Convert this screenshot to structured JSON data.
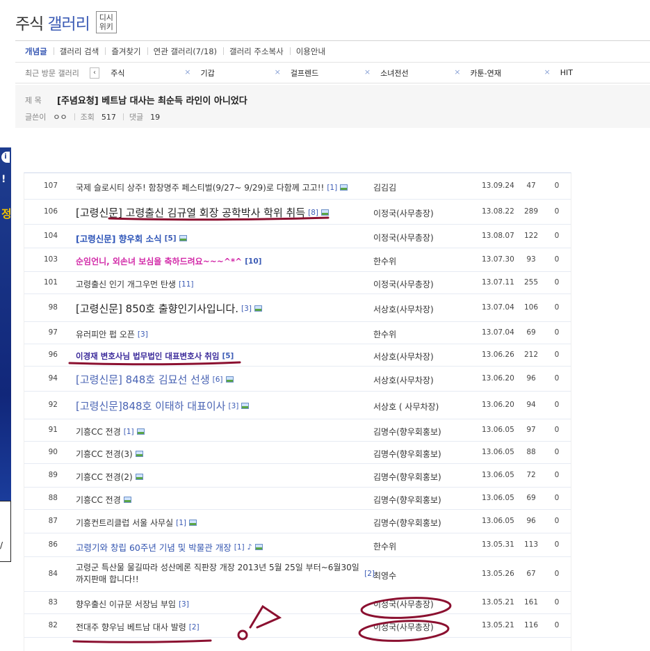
{
  "header": {
    "title_part1": "주식",
    "title_part2": "갤러리",
    "wiki_line1": "디시",
    "wiki_line2": "위키"
  },
  "menu": {
    "items": [
      "개념글",
      "갤러리 검색",
      "즐겨찾기",
      "연관 갤러리(7/18)",
      "갤러리 주소복사",
      "이용안내"
    ]
  },
  "recent": {
    "label": "최근 방문 갤러리",
    "prev_arrow": "‹",
    "close_glyph": "×",
    "galleries": [
      "주식",
      "기갑",
      "걸프렌드",
      "소녀전선",
      "카툰-연재",
      "HIT"
    ]
  },
  "post": {
    "subject_label": "제 목",
    "subject": "[주념요청] 베트남 대사는 최순득 라인이 아니었다",
    "writer_label": "글쓴이",
    "writer": "ㅇㅇ",
    "views_label": "조회",
    "views": "517",
    "comments_label": "댓글",
    "comments": "19"
  },
  "ad": {
    "c1": "i",
    "c2": "!",
    "c3": "정",
    "c4": "/"
  },
  "board": {
    "rows": [
      {
        "num": "107",
        "subject": "국제 슬로시티 상주! 함창명주 페스티벌(9/27~ 9/29)로 다함께 고고!!",
        "comments": "[1]",
        "img": true,
        "style": "",
        "writer": "김김김",
        "date": "13.09.24",
        "views": "47",
        "rec": "0"
      },
      {
        "num": "106",
        "subject": "[고령신문] 고령출신 김규열 회장 공학박사 학위 취득",
        "comments": "[8]",
        "img": true,
        "style": "s-big",
        "writer": "이정국(사무총장)",
        "date": "13.08.22",
        "views": "289",
        "rec": "0"
      },
      {
        "num": "104",
        "subject": "[고령신문] 향우회 소식",
        "comments": "[5]",
        "img": true,
        "style": "s-bold-blue",
        "writer": "이정국(사무총장)",
        "date": "13.08.07",
        "views": "122",
        "rec": "0"
      },
      {
        "num": "103",
        "subject": "순임언니, 외손녀 보심을 축하드려요~~~^*^",
        "comments": "[10]",
        "img": false,
        "style": "s-magenta",
        "writer": "한수위",
        "date": "13.07.30",
        "views": "93",
        "rec": "0"
      },
      {
        "num": "101",
        "subject": "고령출신 인기 개그우먼 탄생",
        "comments": "[11]",
        "img": false,
        "style": "",
        "writer": "이정국(사무총장)",
        "date": "13.07.11",
        "views": "255",
        "rec": "0"
      },
      {
        "num": "98",
        "subject": "[고령신문] 850호 출향인기사입니다.",
        "comments": "[3]",
        "img": true,
        "style": "s-big",
        "writer": "서상호(사무차장)",
        "date": "13.07.04",
        "views": "106",
        "rec": "0"
      },
      {
        "num": "97",
        "subject": "유러피안 펍 오픈",
        "comments": "[3]",
        "img": false,
        "style": "",
        "writer": "한수위",
        "date": "13.07.04",
        "views": "69",
        "rec": "0"
      },
      {
        "num": "96",
        "subject": "이경재 변호사님 법무법인 대표변호사 취임",
        "comments": "[5]",
        "img": false,
        "style": "s-purple",
        "writer": "서상호(사무차장)",
        "date": "13.06.26",
        "views": "212",
        "rec": "0"
      },
      {
        "num": "94",
        "subject": "[고령신문] 848호 김묘선 선생",
        "comments": "[6]",
        "img": true,
        "style": "s-big-blue",
        "writer": "서상호(사무차장)",
        "date": "13.06.20",
        "views": "96",
        "rec": "0"
      },
      {
        "num": "92",
        "subject": "[고령신문]848호 이태하 대표이사",
        "comments": "[3]",
        "img": true,
        "style": "s-big-blue",
        "writer": "서상호 ( 사무차장)",
        "date": "13.06.20",
        "views": "94",
        "rec": "0"
      },
      {
        "num": "91",
        "subject": "기흥CC 전경",
        "comments": "[1]",
        "img": true,
        "style": "",
        "writer": "김명수(향우회홍보)",
        "date": "13.06.05",
        "views": "97",
        "rec": "0"
      },
      {
        "num": "90",
        "subject": "기흥CC 전경(3)",
        "comments": "",
        "img": true,
        "style": "",
        "writer": "김명수(향우회홍보)",
        "date": "13.06.05",
        "views": "88",
        "rec": "0"
      },
      {
        "num": "89",
        "subject": "기흥CC 전경(2)",
        "comments": "",
        "img": true,
        "style": "",
        "writer": "김명수(향우회홍보)",
        "date": "13.06.05",
        "views": "72",
        "rec": "0"
      },
      {
        "num": "88",
        "subject": "기흥CC 전경",
        "comments": "",
        "img": true,
        "style": "",
        "writer": "김명수(향우회홍보)",
        "date": "13.06.05",
        "views": "69",
        "rec": "0"
      },
      {
        "num": "87",
        "subject": "기흥컨트리클럽 서울 사무실",
        "comments": "[1]",
        "img": true,
        "style": "",
        "writer": "김명수(향우회홍보)",
        "date": "13.06.05",
        "views": "96",
        "rec": "0"
      },
      {
        "num": "86",
        "subject": "고령기와 창립 60주년 기념 및 박물관 개장",
        "comments": "[1]",
        "img": true,
        "note": "♪",
        "style": "s-blue",
        "writer": "한수위",
        "date": "13.05.31",
        "views": "113",
        "rec": "0"
      },
      {
        "num": "84",
        "subject": "고령군 특산물 물길따라 성산메론 직판장 개장 2013년 5월 25일 부터~6월30일 까지판매 합니다!!",
        "comments": "[2]",
        "img": false,
        "style": "s-wrap",
        "writer": "최영수",
        "date": "13.05.26",
        "views": "67",
        "rec": "0"
      },
      {
        "num": "83",
        "subject": "향우출신 이규문 서장님 부임",
        "comments": "[3]",
        "img": false,
        "style": "",
        "writer": "이정국(사무총장)",
        "date": "13.05.21",
        "views": "161",
        "rec": "0"
      },
      {
        "num": "82",
        "subject": "전대주 향우님 베트남 대사 발령",
        "comments": "[2]",
        "img": false,
        "style": "",
        "writer": "이정국(사무총장)",
        "date": "13.05.21",
        "views": "116",
        "rec": "0"
      },
      {
        "num": "",
        "subject": "",
        "comments": "",
        "img": false,
        "style": "",
        "writer": "",
        "date": "",
        "views": "",
        "rec": ""
      }
    ]
  },
  "colors": {
    "accent": "#3b5bb5",
    "annotation": "#8b1030"
  }
}
